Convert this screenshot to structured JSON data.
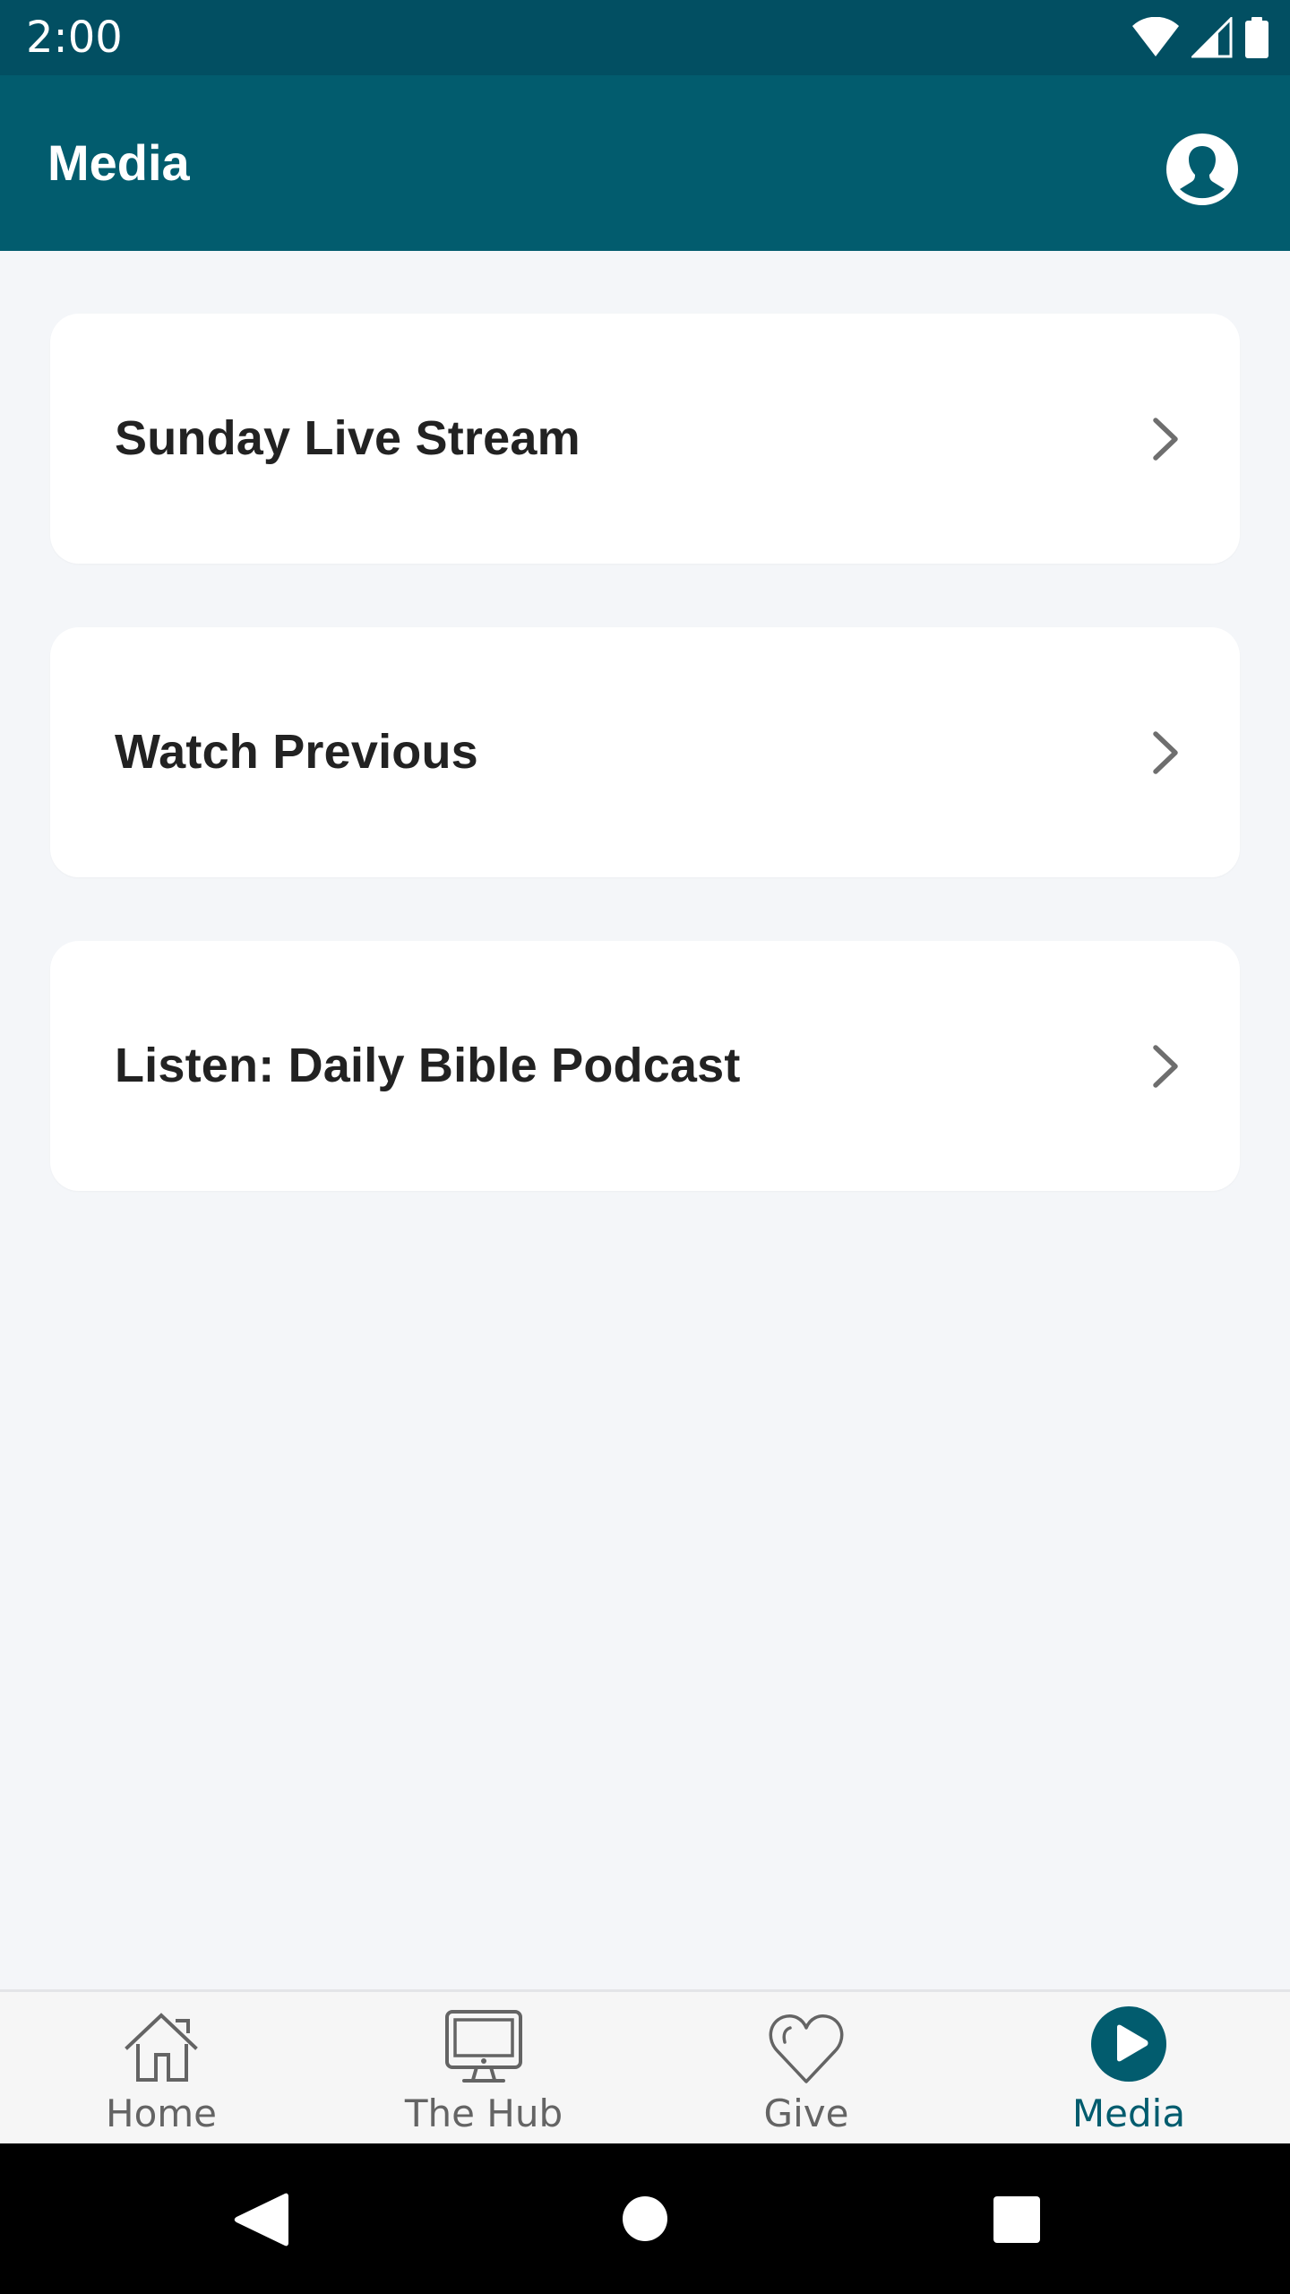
{
  "status_bar": {
    "time": "2:00",
    "icons": [
      "wifi-icon",
      "cell-signal-icon",
      "battery-icon"
    ]
  },
  "app_bar": {
    "title": "Media",
    "profile_icon": "account-circle-icon",
    "color": "#025c6e"
  },
  "menu": {
    "items": [
      {
        "label": "Sunday Live Stream",
        "icon": "chevron-right-icon"
      },
      {
        "label": "Watch Previous",
        "icon": "chevron-right-icon"
      },
      {
        "label": "Listen: Daily Bible Podcast",
        "icon": "chevron-right-icon"
      }
    ]
  },
  "bottom_nav": {
    "active_color": "#025c6e",
    "inactive_color": "#646464",
    "items": [
      {
        "label": "Home",
        "icon": "home-icon",
        "active": false
      },
      {
        "label": "The Hub",
        "icon": "monitor-icon",
        "active": false
      },
      {
        "label": "Give",
        "icon": "heart-icon",
        "active": false
      },
      {
        "label": "Media",
        "icon": "play-circle-icon",
        "active": true
      }
    ]
  },
  "system_nav": {
    "buttons": [
      "back-icon",
      "home-circle-icon",
      "recents-icon"
    ]
  }
}
